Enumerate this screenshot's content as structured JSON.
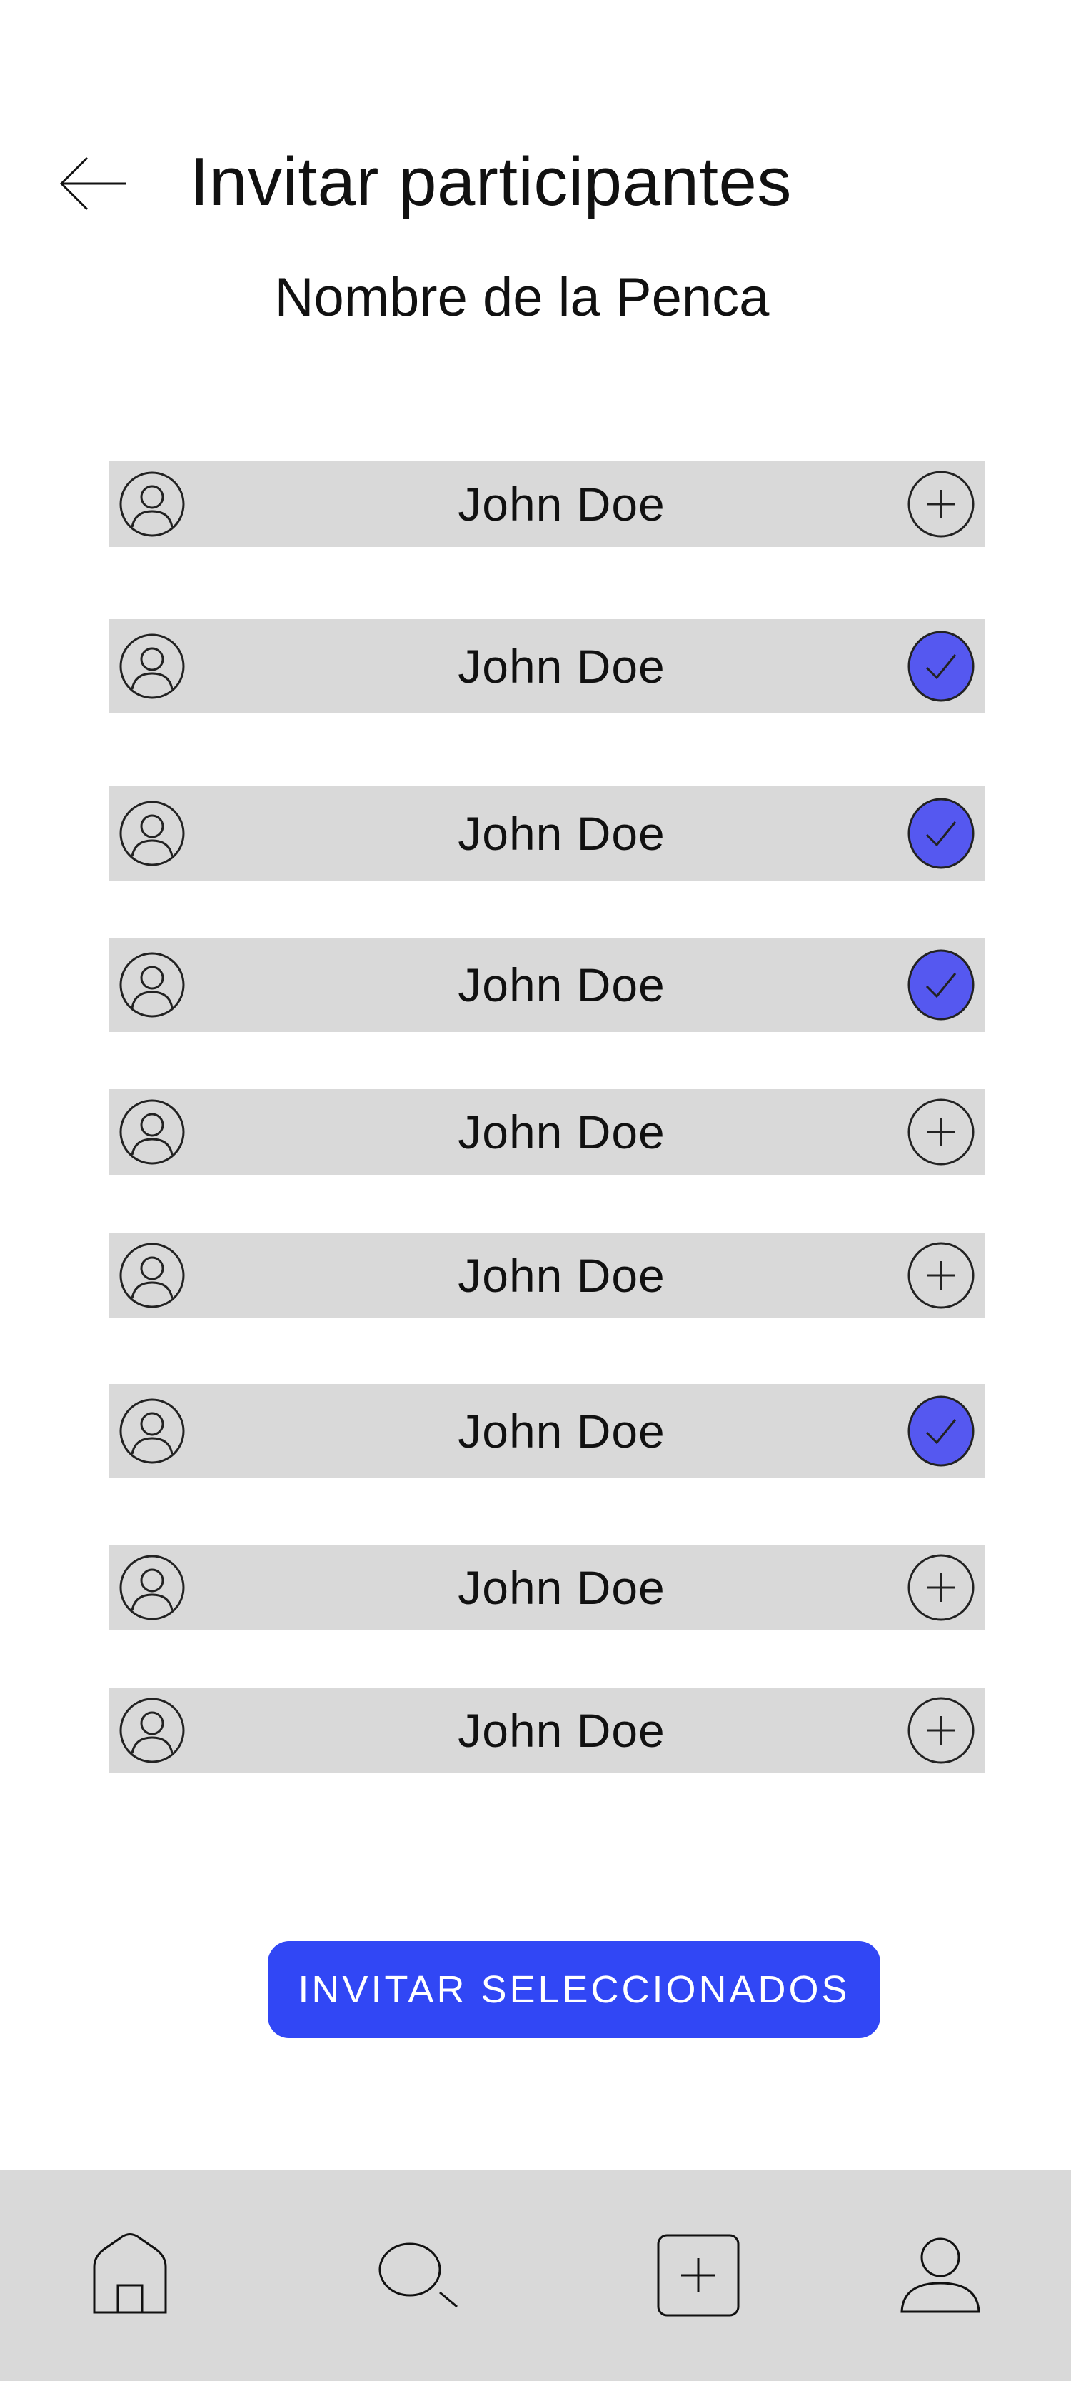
{
  "header": {
    "title": "Invitar participantes",
    "subtitle": "Nombre de la Penca",
    "back_icon": "arrow-left-icon"
  },
  "participants": [
    {
      "name": "John Doe",
      "selected": false
    },
    {
      "name": "John Doe",
      "selected": true
    },
    {
      "name": "John Doe",
      "selected": true
    },
    {
      "name": "John Doe",
      "selected": true
    },
    {
      "name": "John Doe",
      "selected": false
    },
    {
      "name": "John Doe",
      "selected": false
    },
    {
      "name": "John Doe",
      "selected": true
    },
    {
      "name": "John Doe",
      "selected": false
    },
    {
      "name": "John Doe",
      "selected": false
    }
  ],
  "invite_button": {
    "label": "INVITAR SELECCIONADOS"
  },
  "nav": {
    "items": [
      {
        "name": "home",
        "icon": "home-icon"
      },
      {
        "name": "search",
        "icon": "search-icon"
      },
      {
        "name": "create",
        "icon": "add-square-icon"
      },
      {
        "name": "profile",
        "icon": "user-icon"
      }
    ]
  },
  "colors": {
    "row_bg": "#d9d9d9",
    "selected": "#5558f0",
    "button": "#3147f5",
    "nav_bg": "#d9d9d9"
  }
}
